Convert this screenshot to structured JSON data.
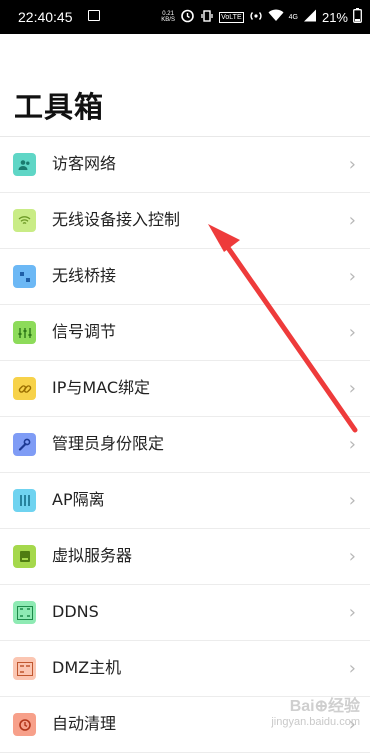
{
  "status_bar": {
    "time": "22:40:45",
    "net_speed": "0.21 KB/S",
    "volte": "VoLTE",
    "network": "4G",
    "battery": "21%"
  },
  "page_title": "工具箱",
  "items": [
    {
      "label": "访客网络",
      "icon": "guest-users-icon",
      "color": "#5fd6c6"
    },
    {
      "label": "无线设备接入控制",
      "icon": "wifi-icon",
      "color": "#b9e36b"
    },
    {
      "label": "无线桥接",
      "icon": "bridge-dots-icon",
      "color": "#6cb8f5"
    },
    {
      "label": "信号调节",
      "icon": "equalizer-icon",
      "color": "#8ddb5a"
    },
    {
      "label": "IP与MAC绑定",
      "icon": "link-icon",
      "color": "#f7d24a"
    },
    {
      "label": "管理员身份限定",
      "icon": "wrench-icon",
      "color": "#7f9cf5"
    },
    {
      "label": "AP隔离",
      "icon": "ap-bars-icon",
      "color": "#6fd3f0"
    },
    {
      "label": "虚拟服务器",
      "icon": "server-icon",
      "color": "#a5d84c"
    },
    {
      "label": "DDNS",
      "icon": "ddns-icon",
      "color": "#6ee39b"
    },
    {
      "label": "DMZ主机",
      "icon": "dmz-icon",
      "color": "#f7a98a"
    },
    {
      "label": "自动清理",
      "icon": "clean-timer-icon",
      "color": "#f7a08a"
    }
  ],
  "chevron": "›",
  "watermark": {
    "logo": "Bai⊕经验",
    "url": "jingyan.baidu.com"
  }
}
